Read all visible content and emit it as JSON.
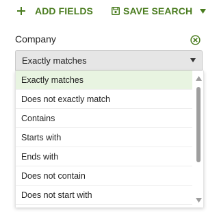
{
  "toolbar": {
    "add_fields_label": "ADD FIELDS",
    "save_search_label": "SAVE SEARCH",
    "icons": [
      "plus-icon",
      "save-icon",
      "caret-down-icon"
    ]
  },
  "field": {
    "label": "Company",
    "remove_icon": "close-circle-icon"
  },
  "select": {
    "selected_value": "Exactly matches"
  },
  "dropdown": {
    "options": [
      {
        "label": "Exactly matches",
        "selected": true
      },
      {
        "label": "Does not exactly match",
        "selected": false
      },
      {
        "label": "Contains",
        "selected": false
      },
      {
        "label": "Starts with",
        "selected": false
      },
      {
        "label": "Ends with",
        "selected": false
      },
      {
        "label": "Does not contain",
        "selected": false
      },
      {
        "label": "Does not start with",
        "selected": false
      }
    ]
  },
  "colors": {
    "accent_green": "#4a7c1f",
    "selected_bg": "#e8f4e1",
    "select_bg": "#e6e6e6"
  }
}
